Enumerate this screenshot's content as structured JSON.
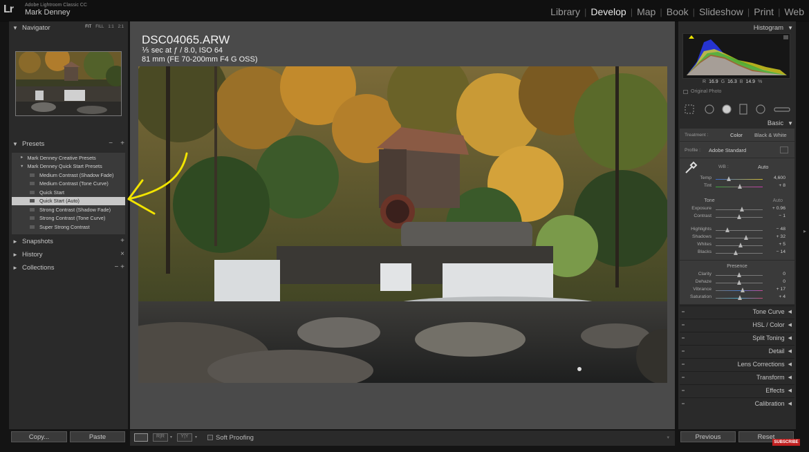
{
  "app": {
    "logo": "Lr",
    "name": "Adobe Lightroom Classic CC",
    "user": "Mark Denney"
  },
  "modules": [
    {
      "label": "Library",
      "active": false
    },
    {
      "label": "Develop",
      "active": true
    },
    {
      "label": "Map",
      "active": false
    },
    {
      "label": "Book",
      "active": false
    },
    {
      "label": "Slideshow",
      "active": false
    },
    {
      "label": "Print",
      "active": false
    },
    {
      "label": "Web",
      "active": false
    }
  ],
  "left_panel": {
    "navigator": {
      "title": "Navigator",
      "options": [
        "FIT",
        "FILL",
        "1:1",
        "2:1"
      ],
      "active_option": "FIT"
    },
    "presets": {
      "title": "Presets",
      "minus": "−",
      "plus": "+",
      "items": [
        {
          "label": "Mark Denney Creative Presets",
          "type": "folder",
          "expanded": false
        },
        {
          "label": "Mark Denney Quick Start Presets",
          "type": "folder",
          "expanded": true
        },
        {
          "label": "Medium Contrast (Shadow Fade)",
          "type": "preset"
        },
        {
          "label": "Medium Contrast (Tone Curve)",
          "type": "preset"
        },
        {
          "label": "Quick Start",
          "type": "preset"
        },
        {
          "label": "Quick Start (Auto)",
          "type": "preset",
          "selected": true
        },
        {
          "label": "Strong Contrast (Shadow Fade)",
          "type": "preset"
        },
        {
          "label": "Strong Contrast (Tone Curve)",
          "type": "preset"
        },
        {
          "label": "Super Strong Contrast",
          "type": "preset"
        }
      ]
    },
    "snapshots": {
      "title": "Snapshots",
      "action": "+"
    },
    "history": {
      "title": "History",
      "action": "×"
    },
    "collections": {
      "title": "Collections",
      "action": "−  +"
    },
    "copy_label": "Copy...",
    "paste_label": "Paste"
  },
  "photo": {
    "filename": "DSC04065.ARW",
    "exposure": "⅕ sec at ƒ / 8.0, ISO 64",
    "lens": "81 mm (FE 70-200mm F4 G OSS)"
  },
  "toolbar": {
    "soft_proofing": "Soft Proofing"
  },
  "right_panel": {
    "histogram_title": "Histogram",
    "rgb": {
      "r_label": "R",
      "r": "16.9",
      "g_label": "G",
      "g": "16.3",
      "b_label": "B",
      "b": "14.9",
      "pct": "%"
    },
    "original_photo": "Original Photo",
    "basic": {
      "title": "Basic",
      "treatment_label": "Treatment :",
      "treatment_color": "Color",
      "treatment_bw": "Black & White",
      "profile_label": "Profile :",
      "profile_value": "Adobe Standard",
      "wb_label": "WB :",
      "wb_value": "Auto",
      "tone_label": "Tone",
      "tone_auto": "Auto",
      "presence_label": "Presence",
      "sliders": [
        {
          "label": "Temp",
          "value": "4,600",
          "pos": 0.28
        },
        {
          "label": "Tint",
          "value": "+ 8",
          "pos": 0.52
        },
        {
          "label": "Exposure",
          "value": "+ 0.96",
          "pos": 0.56
        },
        {
          "label": "Contrast",
          "value": "− 1",
          "pos": 0.5
        },
        {
          "label": "Highlights",
          "value": "− 48",
          "pos": 0.26
        },
        {
          "label": "Shadows",
          "value": "+ 32",
          "pos": 0.66
        },
        {
          "label": "Whites",
          "value": "+ 5",
          "pos": 0.53
        },
        {
          "label": "Blacks",
          "value": "− 14",
          "pos": 0.43
        },
        {
          "label": "Clarity",
          "value": "0",
          "pos": 0.5
        },
        {
          "label": "Dehaze",
          "value": "0",
          "pos": 0.5
        },
        {
          "label": "Vibrance",
          "value": "+ 17",
          "pos": 0.58
        },
        {
          "label": "Saturation",
          "value": "+ 4",
          "pos": 0.52
        }
      ]
    },
    "panels": [
      "Tone Curve",
      "HSL / Color",
      "Split Toning",
      "Detail",
      "Lens Corrections",
      "Transform",
      "Effects",
      "Calibration"
    ],
    "previous_label": "Previous",
    "reset_label": "Reset",
    "subscribe": "SUBSCRIBE"
  },
  "colors": {
    "accent_arrow": "#f2e400",
    "panel_bg": "#2a2a2a",
    "center_bg": "#4a4a4a",
    "selected_preset": "#c8c8c8"
  }
}
